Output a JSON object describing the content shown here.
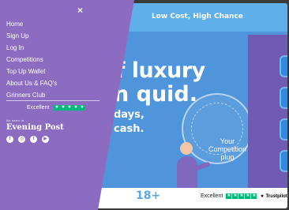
{
  "banner": {
    "text": "Low Cost, High Chance"
  },
  "menu": {
    "close_icon": "×",
    "items": [
      {
        "label": "Home"
      },
      {
        "label": "Sign Up"
      },
      {
        "label": "Log In"
      },
      {
        "label": "Competitions"
      },
      {
        "label": "Top Up Wallet"
      },
      {
        "label": "About Us & FAQ's"
      },
      {
        "label": "Grinners Club"
      }
    ],
    "rating_label": "Excellent",
    "as_seen_in": "As seen in",
    "press_name": "Evening Post",
    "social": [
      {
        "icon": "facebook-icon"
      },
      {
        "icon": "instagram-icon"
      },
      {
        "icon": "twitter-icon"
      },
      {
        "icon": "youtube-icon"
      }
    ]
  },
  "hero": {
    "line1": "elf luxury",
    "line2": "n quid.",
    "line3": "days,",
    "line4": "cash.",
    "promo": "Your Competition plug"
  },
  "bottom": {
    "age": "18+",
    "trust_label": "Excellent",
    "trustpilot": "Trustpilot"
  }
}
